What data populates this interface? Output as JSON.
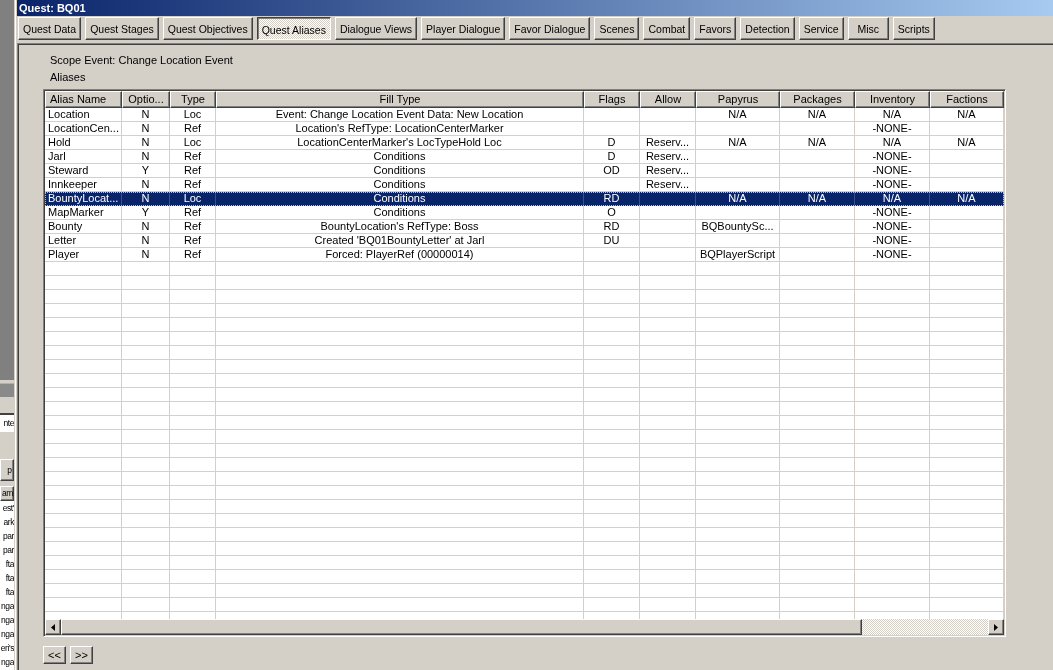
{
  "window": {
    "title": "Quest: BQ01"
  },
  "tabs": [
    {
      "label": "Quest Data",
      "selected": false
    },
    {
      "label": "Quest Stages",
      "selected": false
    },
    {
      "label": "Quest Objectives",
      "selected": false
    },
    {
      "label": "Quest Aliases",
      "selected": true
    },
    {
      "label": "Dialogue Views",
      "selected": false
    },
    {
      "label": "Player Dialogue",
      "selected": false
    },
    {
      "label": "Favor Dialogue",
      "selected": false
    },
    {
      "label": "Scenes",
      "selected": false
    },
    {
      "label": "Combat",
      "selected": false
    },
    {
      "label": "Favors",
      "selected": false
    },
    {
      "label": "Detection",
      "selected": false
    },
    {
      "label": "Service",
      "selected": false
    },
    {
      "label": "Misc",
      "selected": false
    },
    {
      "label": "Scripts",
      "selected": false
    }
  ],
  "scope_event": "Scope Event: Change Location Event",
  "aliases_label": "Aliases",
  "table": {
    "columns": [
      "Alias Name",
      "Optio...",
      "Type",
      "Fill Type",
      "Flags",
      "Allow",
      "Papyrus",
      "Packages",
      "Inventory",
      "Factions"
    ],
    "rows": [
      {
        "selected": false,
        "cells": [
          "Location",
          "N",
          "Loc",
          "Event: Change Location Event Data: New Location",
          null,
          null,
          "N/A",
          "N/A",
          "N/A",
          "N/A"
        ]
      },
      {
        "selected": false,
        "cells": [
          "LocationCen...",
          "N",
          "Ref",
          "Location's RefType: LocationCenterMarker",
          null,
          null,
          null,
          null,
          "-NONE-",
          null
        ]
      },
      {
        "selected": false,
        "cells": [
          "Hold",
          "N",
          "Loc",
          "LocationCenterMarker's LocTypeHold Loc",
          "D",
          "Reserv...",
          "N/A",
          "N/A",
          "N/A",
          "N/A"
        ]
      },
      {
        "selected": false,
        "cells": [
          "Jarl",
          "N",
          "Ref",
          "Conditions",
          "D",
          "Reserv...",
          null,
          null,
          "-NONE-",
          null
        ]
      },
      {
        "selected": false,
        "cells": [
          "Steward",
          "Y",
          "Ref",
          "Conditions",
          "OD",
          "Reserv...",
          null,
          null,
          "-NONE-",
          null
        ]
      },
      {
        "selected": false,
        "cells": [
          "Innkeeper",
          "N",
          "Ref",
          "Conditions",
          null,
          "Reserv...",
          null,
          null,
          "-NONE-",
          null
        ]
      },
      {
        "selected": true,
        "cells": [
          "BountyLocat...",
          "N",
          "Loc",
          "Conditions",
          "RD",
          null,
          "N/A",
          "N/A",
          "N/A",
          "N/A"
        ]
      },
      {
        "selected": false,
        "cells": [
          "MapMarker",
          "Y",
          "Ref",
          "Conditions",
          "O",
          null,
          null,
          null,
          "-NONE-",
          null
        ]
      },
      {
        "selected": false,
        "cells": [
          "Bounty",
          "N",
          "Ref",
          "BountyLocation's RefType: Boss",
          "RD",
          null,
          "BQBountySc...",
          null,
          "-NONE-",
          null
        ]
      },
      {
        "selected": false,
        "cells": [
          "Letter",
          "N",
          "Ref",
          "Created 'BQ01BountyLetter' at Jarl",
          "DU",
          null,
          null,
          null,
          "-NONE-",
          null
        ]
      },
      {
        "selected": false,
        "cells": [
          "Player",
          "N",
          "Ref",
          "Forced: PlayerRef (00000014)",
          null,
          null,
          "BQPlayerScript",
          null,
          "-NONE-",
          null
        ]
      }
    ]
  },
  "nav_buttons": [
    "<<",
    ">>"
  ],
  "background_window": {
    "field_value": "nte",
    "button": "p",
    "column_header": "am",
    "rows": [
      "est'",
      "ark",
      "par",
      "par",
      "fta",
      "fta",
      "fta",
      "nga",
      "nga",
      "nga",
      "eri's",
      "nga"
    ]
  }
}
